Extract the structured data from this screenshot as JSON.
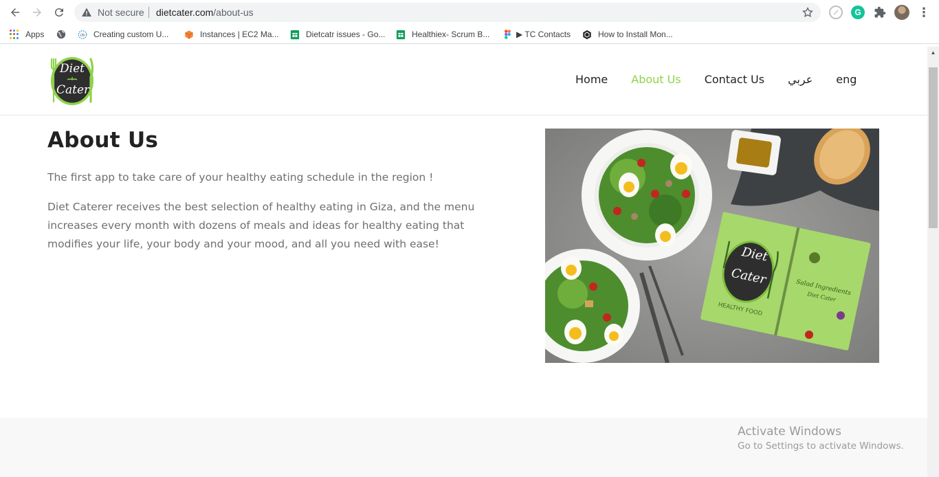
{
  "browser": {
    "security_label": "Not secure",
    "url_host": "dietcater.com",
    "url_path": "/about-us",
    "bookmarks": [
      {
        "label": "Apps",
        "icon": "apps-grid-icon"
      },
      {
        "label": "",
        "icon": "globe-icon"
      },
      {
        "label": "Creating custom U...",
        "icon": "cb-icon"
      },
      {
        "label": "Instances | EC2 Ma...",
        "icon": "aws-cube-icon"
      },
      {
        "label": "Dietcatr issues - Go...",
        "icon": "google-sheets-icon"
      },
      {
        "label": "Healthiex- Scrum B...",
        "icon": "google-sheets-icon"
      },
      {
        "label": "▶ TC Contacts",
        "icon": "figma-icon"
      },
      {
        "label": "How to Install Mon...",
        "icon": "hexagon-icon"
      }
    ]
  },
  "site": {
    "logo_line1": "Diet",
    "logo_line2": "Cater",
    "nav": [
      {
        "label": "Home",
        "active": false
      },
      {
        "label": "About Us",
        "active": true
      },
      {
        "label": "Contact Us",
        "active": false
      },
      {
        "label": "عربي",
        "active": false
      },
      {
        "label": "eng",
        "active": false
      }
    ],
    "accent_color": "#8ed34a"
  },
  "about": {
    "title": "About Us",
    "lead": "The first app to take care of your healthy eating schedule in the region !",
    "body": "Diet Caterer receives the best selection of healthy eating in Giza, and the menu increases every month with dozens of meals and ideas for healthy eating that modifies your life, your body and your mood, and all you need with ease!"
  },
  "hero_image": {
    "notebook_line1": "Diet",
    "notebook_line2": "Cater",
    "notebook_caption": "HEALTHY FOOD",
    "page_title": "Salad Ingredients",
    "page_subtitle": "Diet Cater"
  },
  "watermark": {
    "title": "Activate Windows",
    "subtitle": "Go to Settings to activate Windows."
  }
}
